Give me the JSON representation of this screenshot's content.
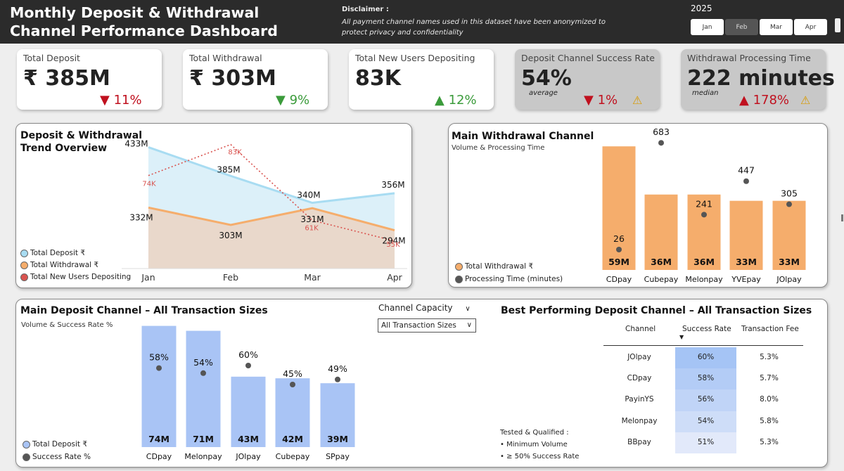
{
  "header": {
    "title_line1": "Monthly Deposit & Withdrawal",
    "title_line2": "Channel Performance Dashboard",
    "disclaimer_label": "Disclaimer :",
    "disclaimer_text": "All payment channel names used in this dataset have been anonymized to protect privacy and confidentiality",
    "year": "2025",
    "months": [
      "Jan",
      "Feb",
      "Mar",
      "Apr"
    ],
    "selected_month": "Feb"
  },
  "kpis": [
    {
      "title": "Total Deposit",
      "value": "₹ 385M",
      "arrow": "▼",
      "change": "11%",
      "trend": "down"
    },
    {
      "title": "Total Withdrawal",
      "value": "₹ 303M",
      "arrow": "▼",
      "change": "9%",
      "trend": "down-good"
    },
    {
      "title": "Total New Users Depositing",
      "value": "83K",
      "arrow": "▲",
      "change": "12%",
      "trend": "up"
    },
    {
      "title": "Deposit Channel Success Rate",
      "value": "54%",
      "sub": "average",
      "arrow": "▼",
      "change": "1%",
      "trend": "down",
      "warning": "⚠"
    },
    {
      "title": "Withdrawal Processing Time",
      "value": "222 minutes",
      "sub": "median",
      "arrow": "▲",
      "change": "178%",
      "trend": "up-bad",
      "warning": "⚠"
    }
  ],
  "trend_panel": {
    "title_line1": "Deposit & Withdrawal",
    "title_line2": "Trend Overview",
    "legend": [
      "Total Deposit ₹",
      "Total Withdrawal ₹",
      "Total New Users Depositing"
    ]
  },
  "withdrawal_panel": {
    "title": "Main Withdrawal Channel",
    "subtitle": "Volume & Processing Time",
    "legend": [
      "Total Withdrawal ₹",
      "Processing Time (minutes)"
    ]
  },
  "deposit_panel": {
    "title": "Main Deposit Channel – All Transaction Sizes",
    "subtitle": "Volume & Success Rate %",
    "legend": [
      "Total Deposit ₹",
      "Success Rate %"
    ],
    "filter_label": "Channel Capacity",
    "filter_value": "All Transaction Sizes"
  },
  "best_panel": {
    "title": "Best Performing Deposit Channel – All Transaction Sizes",
    "columns": [
      "Channel",
      "Success Rate",
      "Transaction Fee"
    ],
    "rows": [
      {
        "channel": "JOlpay",
        "rate": "60%",
        "fee": "5.3%",
        "rate_value": 60
      },
      {
        "channel": "CDpay",
        "rate": "58%",
        "fee": "5.7%",
        "rate_value": 58
      },
      {
        "channel": "PayinYS",
        "rate": "56%",
        "fee": "8.0%",
        "rate_value": 56
      },
      {
        "channel": "Melonpay",
        "rate": "54%",
        "fee": "5.8%",
        "rate_value": 54
      },
      {
        "channel": "BBpay",
        "rate": "51%",
        "fee": "5.3%",
        "rate_value": 51
      }
    ],
    "qualified_title": "Tested & Qualified :",
    "qualified_items": [
      "• Minimum Volume",
      "• ≥  50% Success Rate"
    ]
  },
  "colors": {
    "deposit": "#a9c4f5",
    "deposit_line": "#a8dcf2",
    "withdrawal": "#f5ad6c",
    "users": "#d9534f",
    "dot": "#555555",
    "header": "#2b2b2b"
  },
  "chart_data": [
    {
      "type": "area",
      "title": "Deposit & Withdrawal Trend Overview",
      "categories": [
        "Jan",
        "Feb",
        "Mar",
        "Apr"
      ],
      "series": [
        {
          "name": "Total Deposit ₹",
          "values": [
            433,
            385,
            340,
            356
          ],
          "labels": [
            "433M",
            "385M",
            "340M",
            "356M"
          ]
        },
        {
          "name": "Total Withdrawal ₹",
          "values": [
            332,
            303,
            331,
            294
          ],
          "labels": [
            "332M",
            "303M",
            "331M",
            "294M"
          ]
        },
        {
          "name": "Total New Users Depositing",
          "values": [
            74,
            83,
            61,
            55
          ],
          "labels": [
            "74K",
            "83K",
            "61K",
            "55K"
          ]
        }
      ]
    },
    {
      "type": "bar",
      "title": "Main Withdrawal Channel",
      "categories": [
        "CDpay",
        "Cubepay",
        "Melonpay",
        "YVEpay",
        "JOlpay"
      ],
      "series": [
        {
          "name": "Total Withdrawal ₹",
          "values": [
            59,
            36,
            36,
            33,
            33
          ],
          "labels": [
            "59M",
            "36M",
            "36M",
            "33M",
            "33M"
          ]
        },
        {
          "name": "Processing Time (minutes)",
          "values": [
            26,
            683,
            241,
            447,
            305
          ],
          "labels": [
            "26",
            "683",
            "241",
            "447",
            "305"
          ]
        }
      ]
    },
    {
      "type": "bar",
      "title": "Main Deposit Channel – All Transaction Sizes",
      "categories": [
        "CDpay",
        "Melonpay",
        "JOlpay",
        "Cubepay",
        "SPpay"
      ],
      "series": [
        {
          "name": "Total Deposit ₹",
          "values": [
            74,
            71,
            43,
            42,
            39
          ],
          "labels": [
            "74M",
            "71M",
            "43M",
            "42M",
            "39M"
          ]
        },
        {
          "name": "Success Rate %",
          "values": [
            58,
            54,
            60,
            45,
            49
          ],
          "labels": [
            "58%",
            "54%",
            "60%",
            "45%",
            "49%"
          ]
        }
      ]
    }
  ]
}
